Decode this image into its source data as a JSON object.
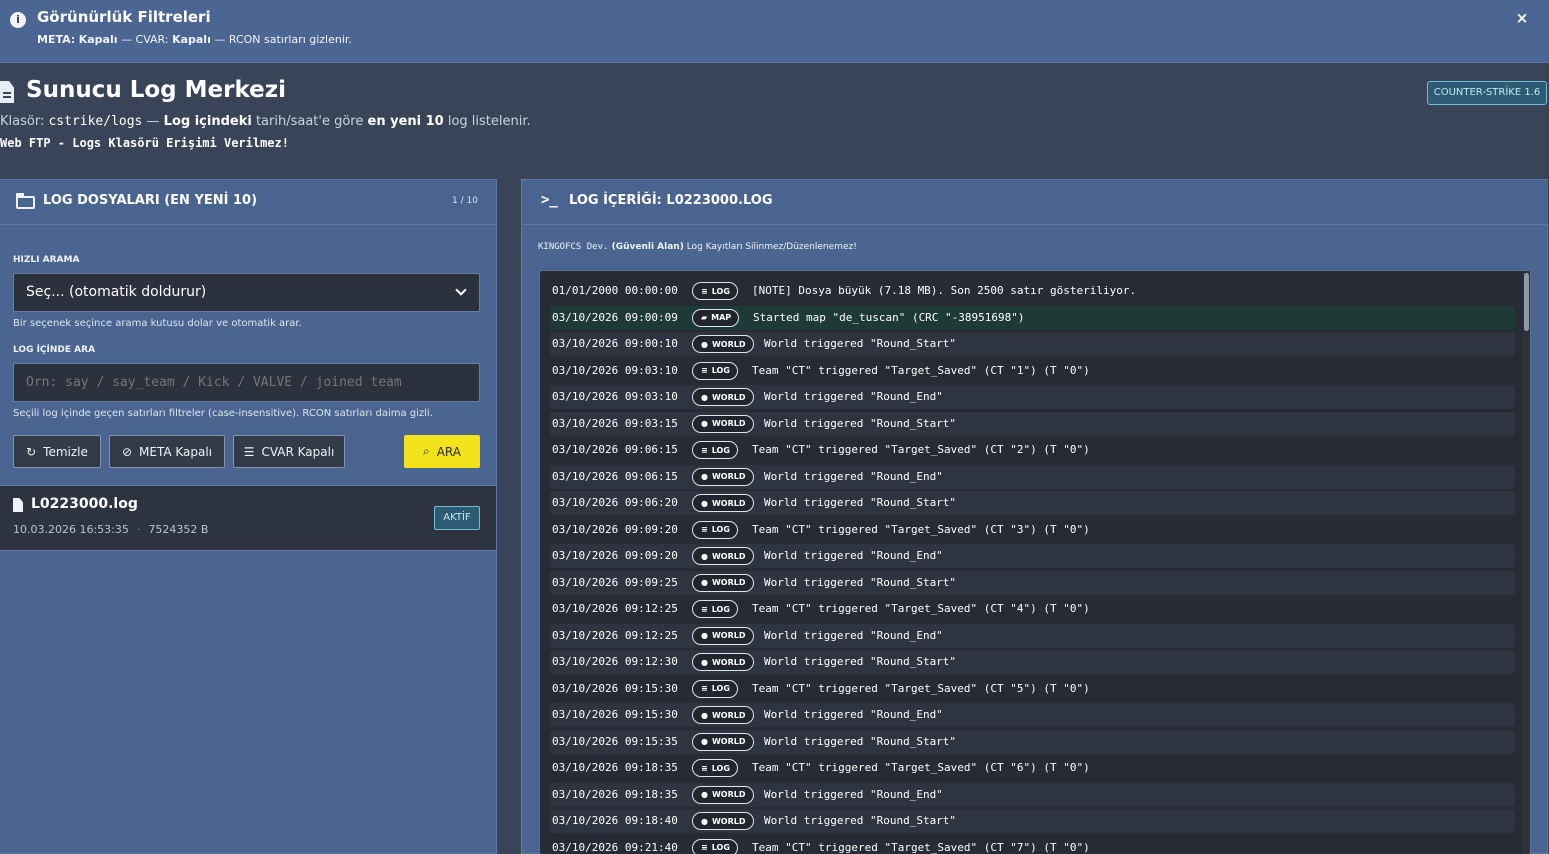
{
  "notice": {
    "title": "Görünürlük Filtreleri",
    "meta_label": "META:",
    "meta_state": "Kapalı",
    "sep1": " — CVAR: ",
    "cvar_state": "Kapalı",
    "rest": " — RCON satırları gizlenir.",
    "close": "×",
    "info_icon": "info-icon",
    "close_icon": "close-icon"
  },
  "header": {
    "title": "Sunucu Log Merkezi",
    "game_badge": "COUNTER-STRİKE 1.6",
    "sub_prefix": "Klasör: ",
    "sub_folder": "cstrike/logs",
    "sub_mid1": " — ",
    "sub_bold1": "Log içindeki",
    "sub_mid2": " tarih/saat'e göre ",
    "sub_bold2": "en yeni 10",
    "sub_end": " log listelenir.",
    "warning": "Web FTP - Logs Klasörü Erişimi Verilmez!"
  },
  "left": {
    "title": "LOG DOSYALARI (EN YENİ 10)",
    "count": "1 / 10",
    "quick_label": "HIZLI ARAMA",
    "select_value": "Seç... (otomatik doldurur)",
    "select_hint": "Bir seçenek seçince arama kutusu dolar ve otomatik arar.",
    "search_label": "LOG İÇİNDE ARA",
    "search_placeholder": "Örn: say / say_team / Kick / VALVE / joined team",
    "search_hint": "Seçili log içinde geçen satırları filtreler (case-insensitive). RCON satırları daima gizli.",
    "buttons": {
      "clear": "Temizle",
      "meta": "META Kapalı",
      "cvar": "CVAR Kapalı",
      "search": "ARA"
    },
    "file": {
      "name": "L0223000.log",
      "date": "10.03.2026 16:53:35",
      "size": "7524352 B",
      "badge": "AKTİF"
    }
  },
  "right": {
    "title": "LOG İÇERİĞİ: L0223000.LOG",
    "note_mono": "KINGOFCS Dev.",
    "note_bold": " (Güvenli Alan)",
    "note_rest": " Log Kayıtları Silinmez/Düzenlenemez!",
    "rows": [
      {
        "ts": "01/01/2000 00:00:00",
        "tag": "LOG",
        "icon": "≡",
        "msg": "[NOTE] Dosya büyük (7.18 MB). Son 2500 satır gösteriliyor.",
        "style": "plain"
      },
      {
        "ts": "03/10/2026 09:00:09",
        "tag": "MAP",
        "icon": "▰",
        "msg": "Started map \"de_tuscan\" (CRC \"-38951698\")",
        "style": "map"
      },
      {
        "ts": "03/10/2026 09:00:10",
        "tag": "WORLD",
        "icon": "●",
        "msg": "World triggered \"Round_Start\"",
        "style": "alt"
      },
      {
        "ts": "03/10/2026 09:03:10",
        "tag": "LOG",
        "icon": "≡",
        "msg": "Team \"CT\" triggered \"Target_Saved\" (CT \"1\") (T \"0\")",
        "style": "plain"
      },
      {
        "ts": "03/10/2026 09:03:10",
        "tag": "WORLD",
        "icon": "●",
        "msg": "World triggered \"Round_End\"",
        "style": "alt"
      },
      {
        "ts": "03/10/2026 09:03:15",
        "tag": "WORLD",
        "icon": "●",
        "msg": "World triggered \"Round_Start\"",
        "style": "alt"
      },
      {
        "ts": "03/10/2026 09:06:15",
        "tag": "LOG",
        "icon": "≡",
        "msg": "Team \"CT\" triggered \"Target_Saved\" (CT \"2\") (T \"0\")",
        "style": "plain"
      },
      {
        "ts": "03/10/2026 09:06:15",
        "tag": "WORLD",
        "icon": "●",
        "msg": "World triggered \"Round_End\"",
        "style": "alt"
      },
      {
        "ts": "03/10/2026 09:06:20",
        "tag": "WORLD",
        "icon": "●",
        "msg": "World triggered \"Round_Start\"",
        "style": "alt"
      },
      {
        "ts": "03/10/2026 09:09:20",
        "tag": "LOG",
        "icon": "≡",
        "msg": "Team \"CT\" triggered \"Target_Saved\" (CT \"3\") (T \"0\")",
        "style": "plain"
      },
      {
        "ts": "03/10/2026 09:09:20",
        "tag": "WORLD",
        "icon": "●",
        "msg": "World triggered \"Round_End\"",
        "style": "alt"
      },
      {
        "ts": "03/10/2026 09:09:25",
        "tag": "WORLD",
        "icon": "●",
        "msg": "World triggered \"Round_Start\"",
        "style": "alt"
      },
      {
        "ts": "03/10/2026 09:12:25",
        "tag": "LOG",
        "icon": "≡",
        "msg": "Team \"CT\" triggered \"Target_Saved\" (CT \"4\") (T \"0\")",
        "style": "plain"
      },
      {
        "ts": "03/10/2026 09:12:25",
        "tag": "WORLD",
        "icon": "●",
        "msg": "World triggered \"Round_End\"",
        "style": "alt"
      },
      {
        "ts": "03/10/2026 09:12:30",
        "tag": "WORLD",
        "icon": "●",
        "msg": "World triggered \"Round_Start\"",
        "style": "alt"
      },
      {
        "ts": "03/10/2026 09:15:30",
        "tag": "LOG",
        "icon": "≡",
        "msg": "Team \"CT\" triggered \"Target_Saved\" (CT \"5\") (T \"0\")",
        "style": "plain"
      },
      {
        "ts": "03/10/2026 09:15:30",
        "tag": "WORLD",
        "icon": "●",
        "msg": "World triggered \"Round_End\"",
        "style": "alt"
      },
      {
        "ts": "03/10/2026 09:15:35",
        "tag": "WORLD",
        "icon": "●",
        "msg": "World triggered \"Round_Start\"",
        "style": "alt"
      },
      {
        "ts": "03/10/2026 09:18:35",
        "tag": "LOG",
        "icon": "≡",
        "msg": "Team \"CT\" triggered \"Target_Saved\" (CT \"6\") (T \"0\")",
        "style": "plain"
      },
      {
        "ts": "03/10/2026 09:18:35",
        "tag": "WORLD",
        "icon": "●",
        "msg": "World triggered \"Round_End\"",
        "style": "alt"
      },
      {
        "ts": "03/10/2026 09:18:40",
        "tag": "WORLD",
        "icon": "●",
        "msg": "World triggered \"Round_Start\"",
        "style": "alt"
      },
      {
        "ts": "03/10/2026 09:21:40",
        "tag": "LOG",
        "icon": "≡",
        "msg": "Team \"CT\" triggered \"Target_Saved\" (CT \"7\") (T \"0\")",
        "style": "plain"
      }
    ]
  }
}
